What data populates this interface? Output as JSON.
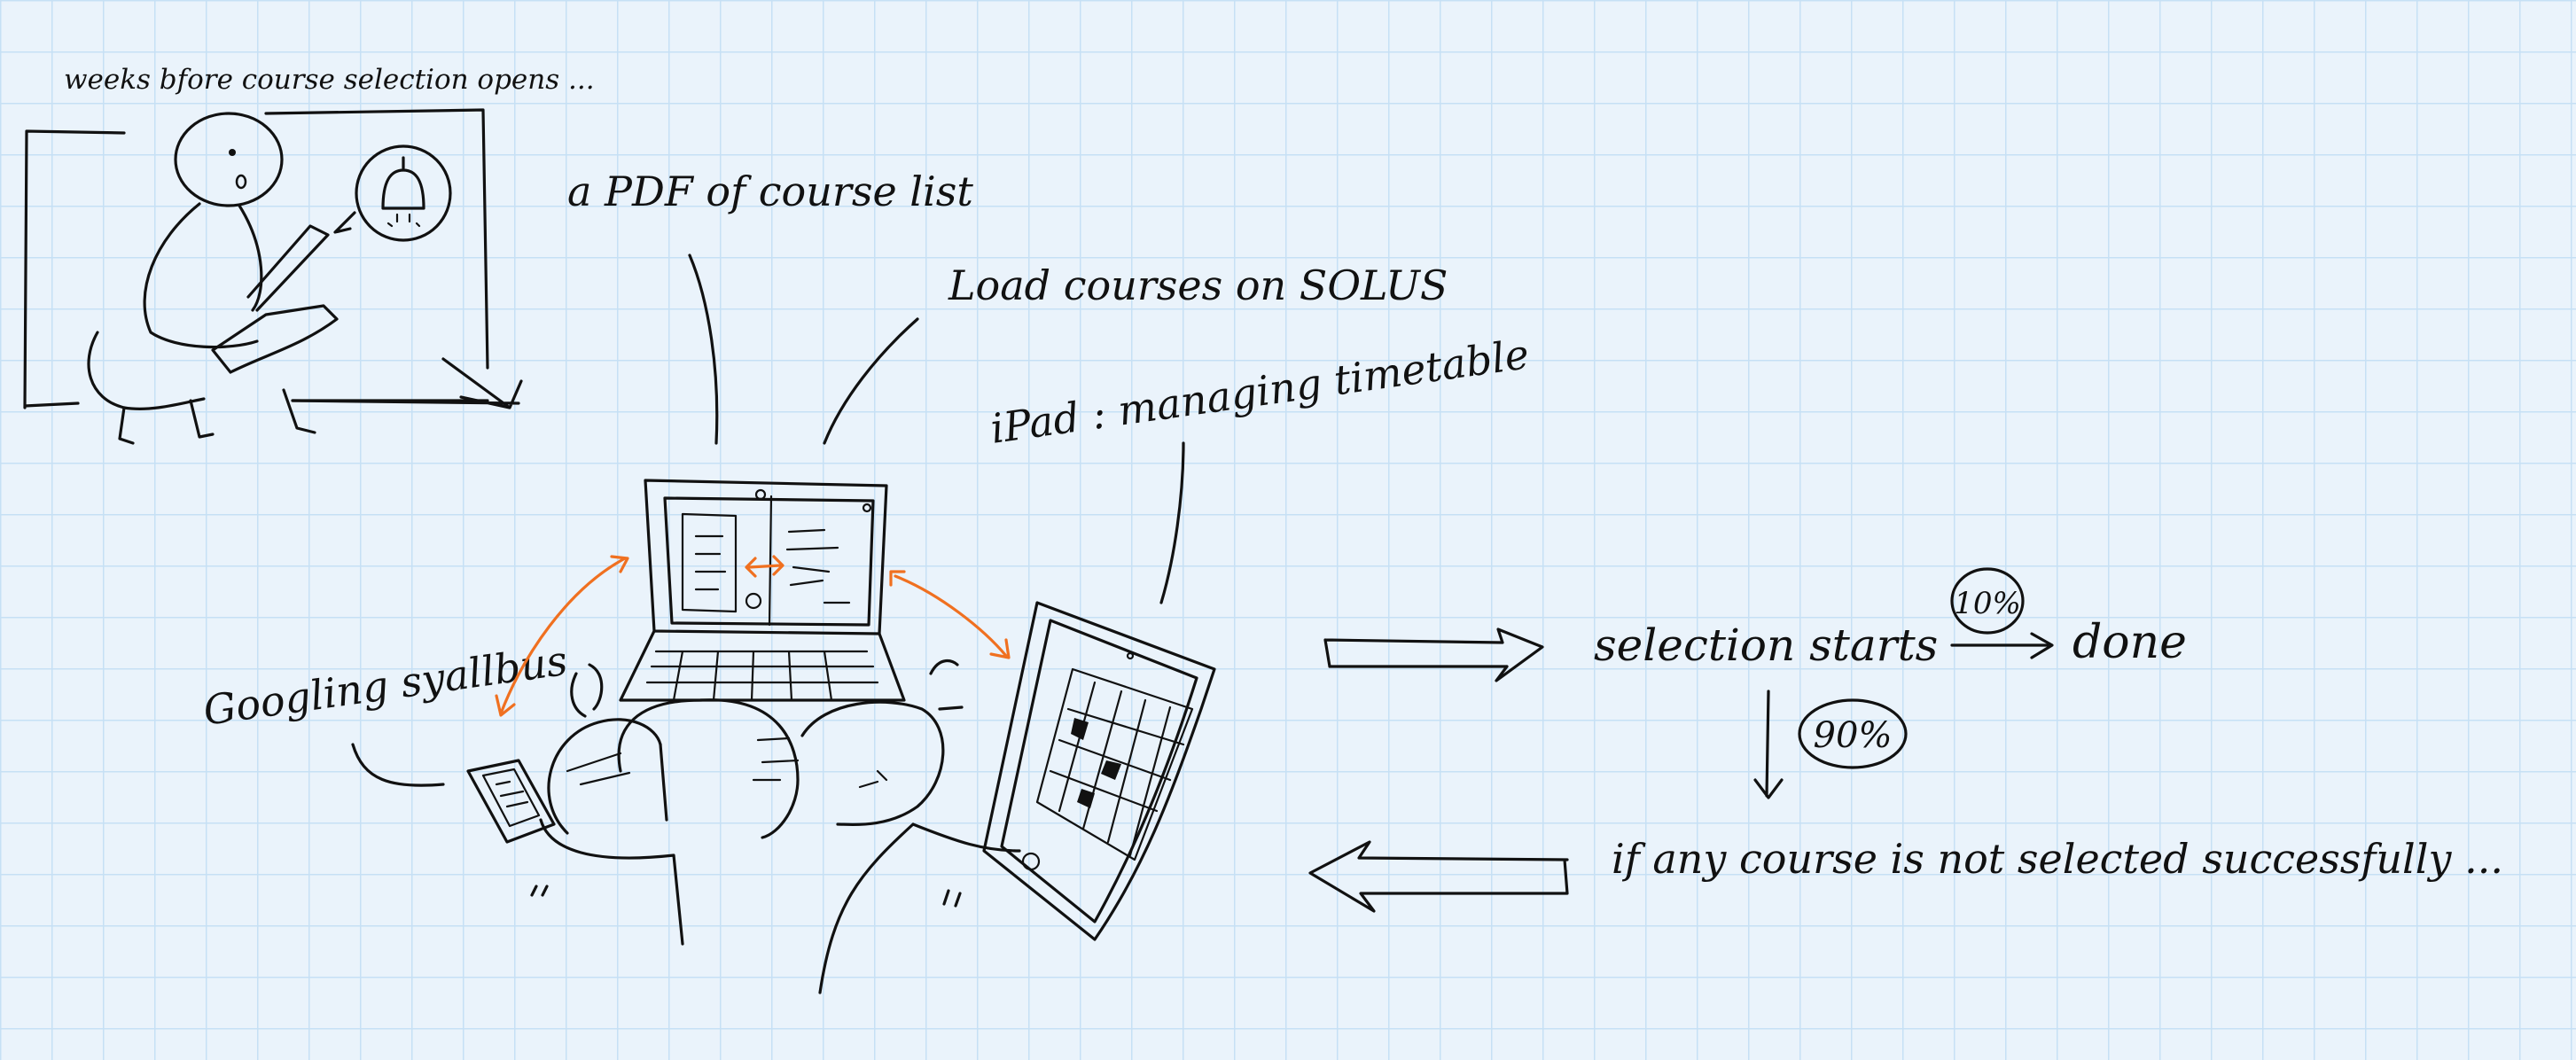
{
  "labels": {
    "weeks_before": "weeks bfore course selection opens ...",
    "pdf_list": "a PDF of course list",
    "load_courses": "Load courses on SOLUS",
    "ipad": "iPad : managing timetable",
    "googling": "Googling syallbus",
    "selection_starts": "selection starts",
    "pct_done": "10%",
    "done": "done",
    "pct_fail": "90%",
    "if_not_selected": "if any course is not selected successfully ..."
  },
  "colors": {
    "ink": "#111111",
    "accent_arrows": "#f07020",
    "paper": "#eaf3fb",
    "grid": "#c6e0f5"
  },
  "icons": [
    "bell-icon",
    "laptop-icon",
    "ipad-icon",
    "phone-icon"
  ]
}
